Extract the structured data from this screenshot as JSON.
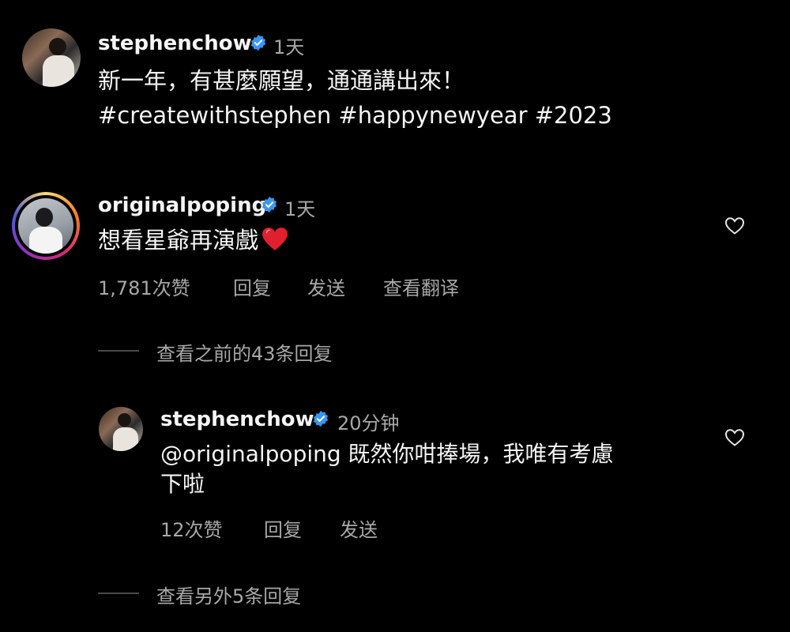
{
  "post": {
    "username": "stephenchow",
    "time": "1天",
    "caption_line1": "新一年，有甚麼願望，通通講出來！",
    "caption_line2": "#createwithstephen #happynewyear #2023"
  },
  "comment": {
    "username": "originalpoping",
    "time": "1天",
    "text": "想看星爺再演戲",
    "emoji": "heart",
    "likes": "1,781次赞",
    "reply_label": "回复",
    "send_label": "发送",
    "translate_label": "查看翻译",
    "view_previous_replies": "查看之前的43条回复"
  },
  "reply": {
    "username": "stephenchow",
    "time": "20分钟",
    "text_line1": "@originalpoping 既然你咁捧場，我唯有考慮",
    "text_line2": "下啦",
    "likes": "12次赞",
    "reply_label": "回复",
    "send_label": "发送",
    "view_more_replies": "查看另外5条回复"
  },
  "colors": {
    "background": "#000000",
    "text_primary": "#f5f5f5",
    "text_secondary": "#a8a8a8",
    "verified_badge": "#3897f0",
    "heart_emoji": "#e0202e"
  }
}
